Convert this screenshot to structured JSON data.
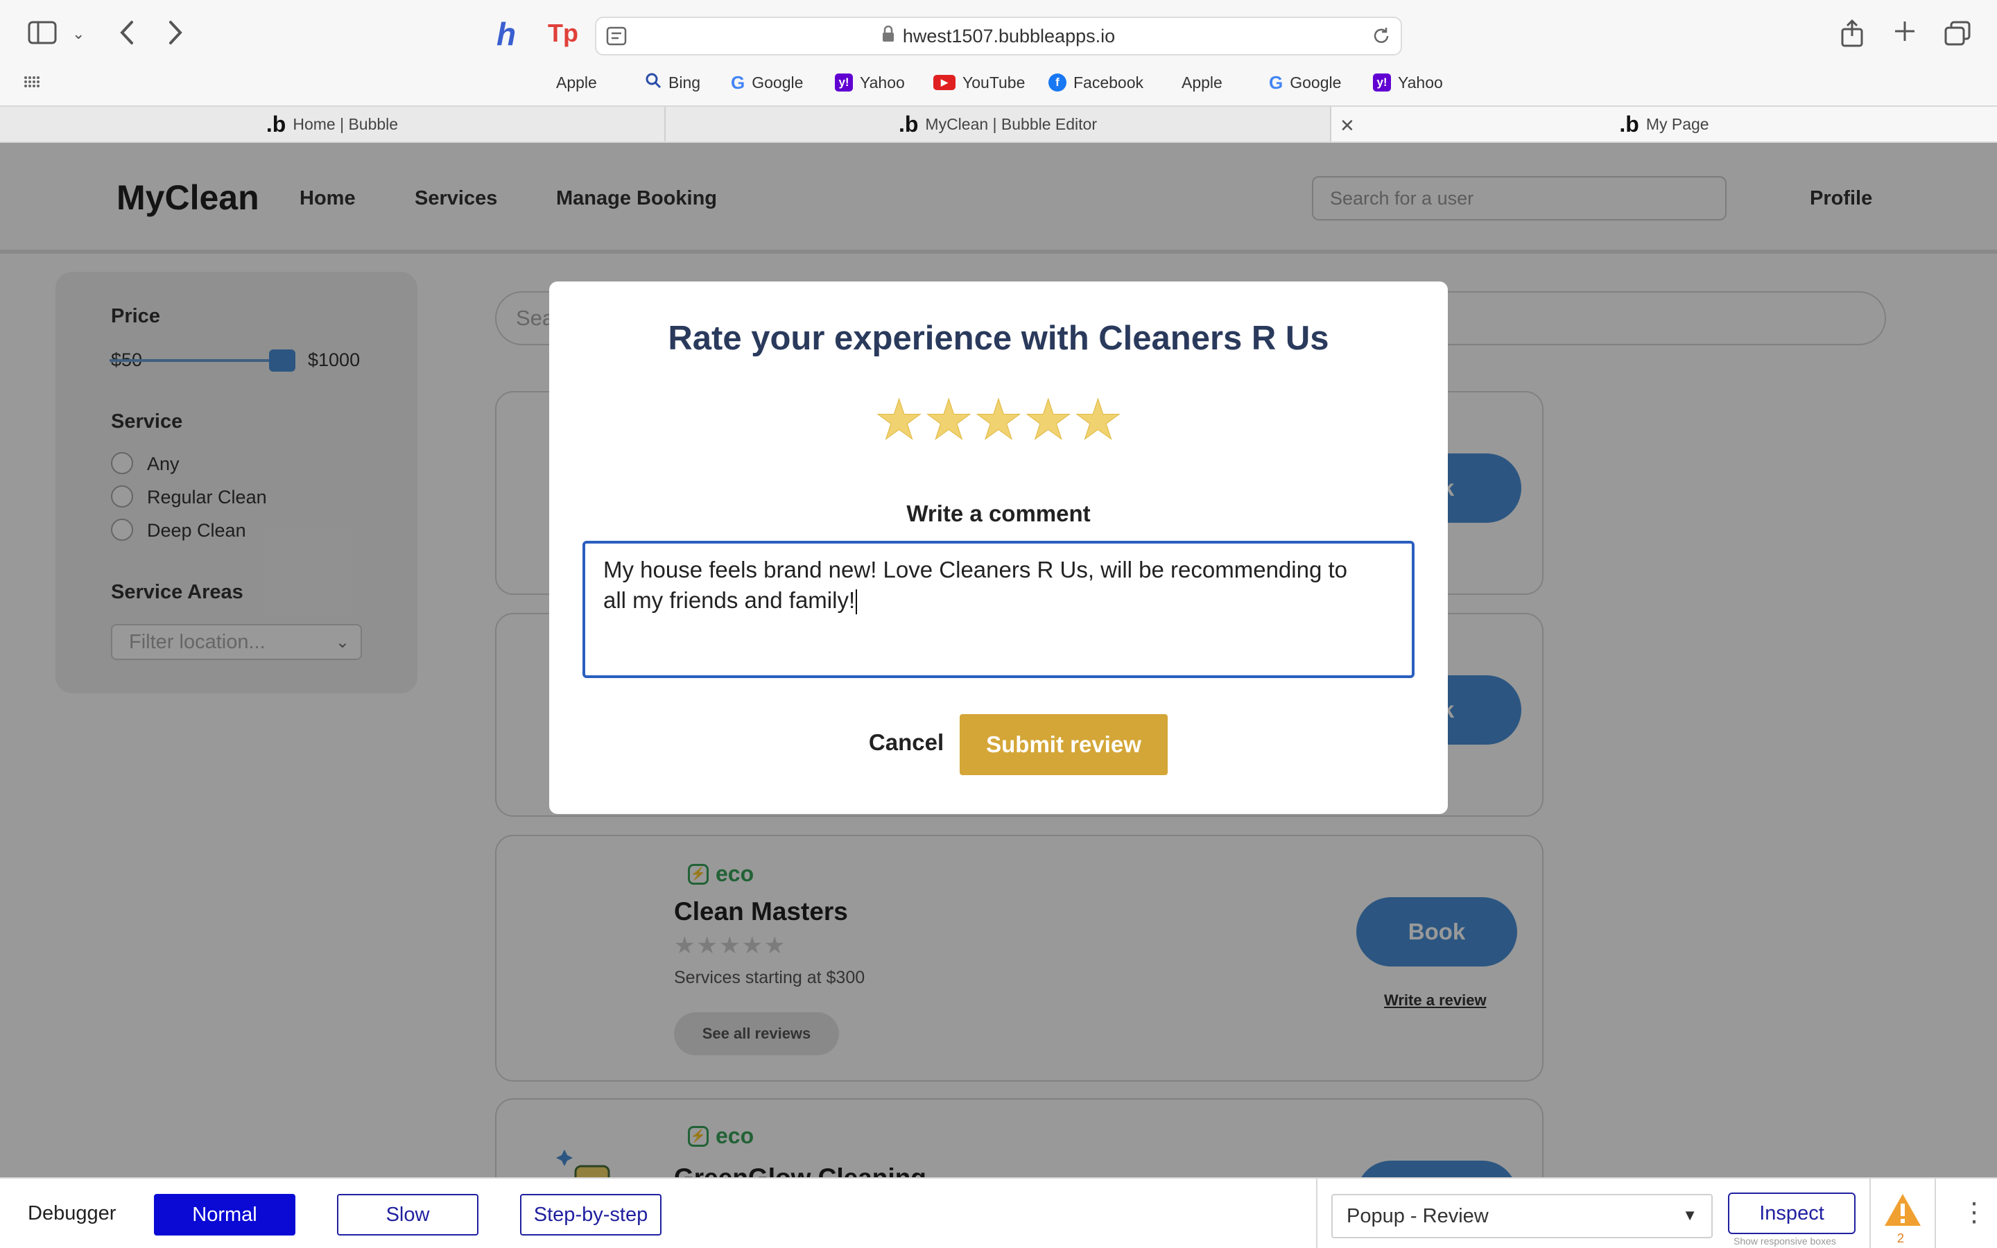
{
  "browser": {
    "url": "hwest1507.bubbleapps.io",
    "bookmarks": [
      {
        "label": "Apple",
        "icon": "apple-icon"
      },
      {
        "label": "Bing",
        "icon": "search-icon"
      },
      {
        "label": "Google",
        "icon": "google-icon"
      },
      {
        "label": "Yahoo",
        "icon": "yahoo-icon"
      },
      {
        "label": "YouTube",
        "icon": "youtube-icon"
      },
      {
        "label": "Facebook",
        "icon": "facebook-icon"
      },
      {
        "label": "Apple",
        "icon": "apple-icon"
      },
      {
        "label": "Google",
        "icon": "google-icon"
      },
      {
        "label": "Yahoo",
        "icon": "yahoo-icon"
      }
    ],
    "tabs": [
      {
        "label": "Home | Bubble"
      },
      {
        "label": "MyClean | Bubble Editor"
      },
      {
        "label": "My Page"
      }
    ]
  },
  "header": {
    "brand": "MyClean",
    "nav": [
      "Home",
      "Services",
      "Manage Booking"
    ],
    "search_placeholder": "Search for a user",
    "profile": "Profile"
  },
  "filters": {
    "price_title": "Price",
    "price_min": "$50",
    "price_max": "$1000",
    "service_title": "Service",
    "service_options": [
      "Any",
      "Regular Clean",
      "Deep Clean"
    ],
    "areas_title": "Service Areas",
    "location_placeholder": "Filter location..."
  },
  "main_search_placeholder": "Sea",
  "cards": [
    {
      "book": "ok",
      "review": "eview"
    },
    {
      "book": "ok",
      "review": "eview"
    },
    {
      "eco": "eco",
      "title": "Clean Masters",
      "stars": "★★★★★",
      "sub": "Services starting at $300",
      "see": "See all reviews",
      "book": "Book",
      "review": "Write a review"
    },
    {
      "eco": "eco",
      "title": "GreenGlow Cleaning"
    }
  ],
  "modal": {
    "title": "Rate your experience with Cleaners R Us",
    "rating": 5,
    "comment_label": "Write a comment",
    "comment_line1": "My house feels brand new! Love Cleaners R Us, will be recommending to",
    "comment_line2": "all my friends and family!",
    "cancel": "Cancel",
    "submit": "Submit review"
  },
  "debugger": {
    "label": "Debugger",
    "modes": [
      "Normal",
      "Slow",
      "Step-by-step"
    ],
    "element": "Popup - Review",
    "inspect": "Inspect",
    "responsive": "Show responsive boxes",
    "warnings": "2"
  },
  "colors": {
    "accent_gold": "#d4a637",
    "title_navy": "#2a3a5c",
    "focus_blue": "#2b5fbf",
    "book_blue": "#4a8fd8",
    "eco_green": "#3aa35a"
  }
}
